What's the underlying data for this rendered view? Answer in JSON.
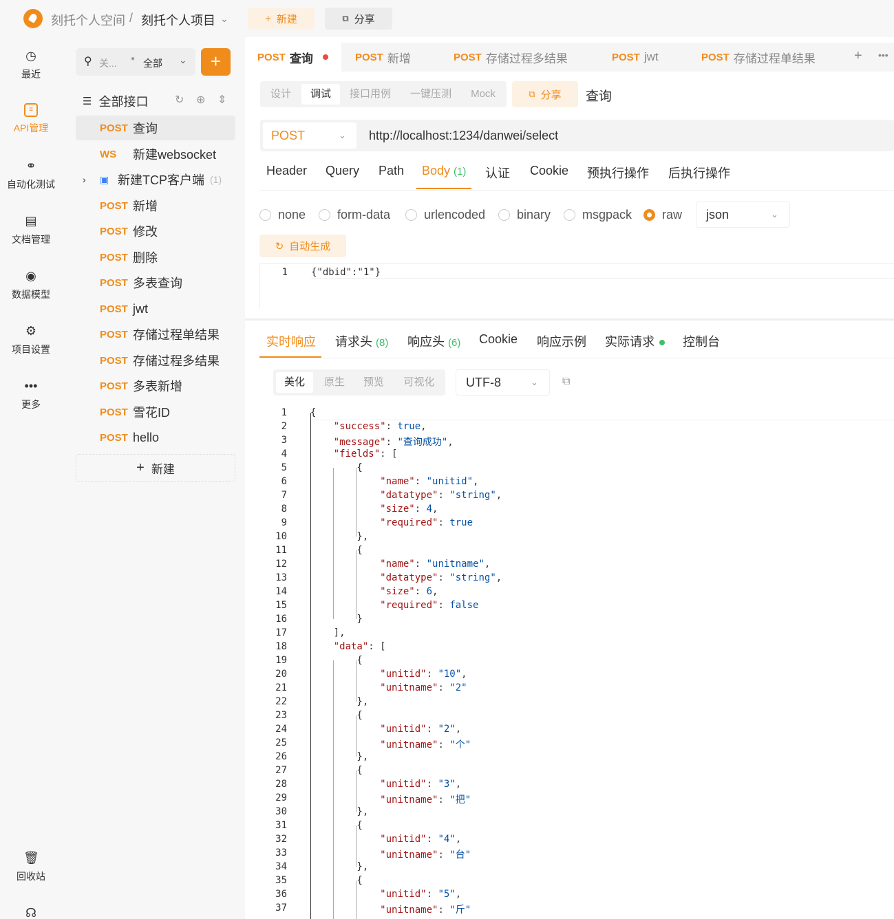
{
  "topbar": {
    "workspace": "刻托个人空间",
    "separator": "/",
    "project": "刻托个人项目",
    "new_label": "新建",
    "share_label": "分享"
  },
  "rail": {
    "items": [
      {
        "label": "最近",
        "icon": "clock-icon"
      },
      {
        "label": "API管理",
        "icon": "api-icon"
      },
      {
        "label": "自动化测试",
        "icon": "automation-icon"
      },
      {
        "label": "文档管理",
        "icon": "document-icon"
      },
      {
        "label": "数据模型",
        "icon": "data-model-icon"
      },
      {
        "label": "项目设置",
        "icon": "settings-icon"
      },
      {
        "label": "更多",
        "icon": "more-icon"
      },
      {
        "label": "回收站",
        "icon": "trash-icon"
      }
    ]
  },
  "panel": {
    "search_placeholder": "关...",
    "filter": "全部",
    "tree_title": "全部接口",
    "items": [
      {
        "method": "POST",
        "name": "查询"
      },
      {
        "method": "WS",
        "name": "新建websocket"
      },
      {
        "method": "",
        "name": "新建TCP客户端",
        "count": "(1)"
      },
      {
        "method": "POST",
        "name": "新增"
      },
      {
        "method": "POST",
        "name": "修改"
      },
      {
        "method": "POST",
        "name": "删除"
      },
      {
        "method": "POST",
        "name": "多表查询"
      },
      {
        "method": "POST",
        "name": "jwt"
      },
      {
        "method": "POST",
        "name": "存储过程单结果"
      },
      {
        "method": "POST",
        "name": "存储过程多结果"
      },
      {
        "method": "POST",
        "name": "多表新增"
      },
      {
        "method": "POST",
        "name": "雪花ID"
      },
      {
        "method": "POST",
        "name": "hello"
      }
    ],
    "new_label": "新建"
  },
  "tabs": [
    {
      "method": "POST",
      "name": "查询"
    },
    {
      "method": "POST",
      "name": "新增"
    },
    {
      "method": "POST",
      "name": "存储过程多结果"
    },
    {
      "method": "POST",
      "name": "jwt"
    },
    {
      "method": "POST",
      "name": "存储过程单结果"
    }
  ],
  "subtabs": [
    "设计",
    "调试",
    "接口用例",
    "一键压测",
    "Mock"
  ],
  "share_label": "分享",
  "api_title": "查询",
  "request": {
    "method": "POST",
    "url": "http://localhost:1234/danwei/select",
    "tabs": [
      "Header",
      "Query",
      "Path",
      "Body",
      "认证",
      "Cookie",
      "预执行操作",
      "后执行操作"
    ],
    "body_count": "(1)",
    "body_types": [
      "none",
      "form-data",
      "urlencoded",
      "binary",
      "msgpack",
      "raw"
    ],
    "raw_format": "json",
    "autogen_label": "自动生成",
    "body_line": "1",
    "body_text": "{\"dbid\":\"1\"}"
  },
  "response": {
    "tabs": [
      "实时响应",
      "请求头",
      "响应头",
      "Cookie",
      "响应示例",
      "实际请求",
      "控制台"
    ],
    "req_header_count": "(8)",
    "resp_header_count": "(6)",
    "view_modes": [
      "美化",
      "原生",
      "预览",
      "可视化"
    ],
    "encoding": "UTF-8"
  },
  "response_lines": [
    "{",
    "    \"success\": true,",
    "    \"message\": \"查询成功\",",
    "    \"fields\": [",
    "        {",
    "            \"name\": \"unitid\",",
    "            \"datatype\": \"string\",",
    "            \"size\": 4,",
    "            \"required\": true",
    "        },",
    "        {",
    "            \"name\": \"unitname\",",
    "            \"datatype\": \"string\",",
    "            \"size\": 6,",
    "            \"required\": false",
    "        }",
    "    ],",
    "    \"data\": [",
    "        {",
    "            \"unitid\": \"10\",",
    "            \"unitname\": \"2\"",
    "        },",
    "        {",
    "            \"unitid\": \"2\",",
    "            \"unitname\": \"个\"",
    "        },",
    "        {",
    "            \"unitid\": \"3\",",
    "            \"unitname\": \"把\"",
    "        },",
    "        {",
    "            \"unitid\": \"4\",",
    "            \"unitname\": \"台\"",
    "        },",
    "        {",
    "            \"unitid\": \"5\",",
    "            \"unitname\": \"斤\""
  ],
  "colors": {
    "accent": "#f08c1c",
    "count_green": "#3fbf6a"
  }
}
